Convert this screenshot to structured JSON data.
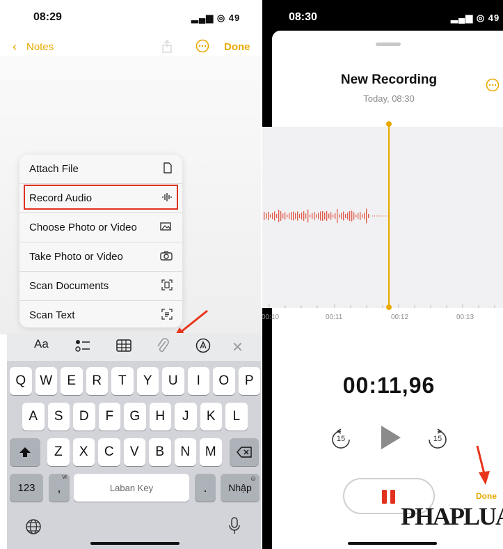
{
  "left_phone": {
    "status": {
      "time": "08:29",
      "icons": "▂▄▆ ◎ 49"
    },
    "nav": {
      "back_label": "Notes",
      "done_label": "Done"
    },
    "attach_menu": {
      "items": [
        {
          "label": "Attach File",
          "icon": "doc-icon"
        },
        {
          "label": "Record Audio",
          "icon": "waveform-icon"
        },
        {
          "label": "Choose Photo or Video",
          "icon": "photo-icon"
        },
        {
          "label": "Take Photo or Video",
          "icon": "camera-icon"
        },
        {
          "label": "Scan Documents",
          "icon": "scan-doc-icon"
        },
        {
          "label": "Scan Text",
          "icon": "scan-text-icon"
        }
      ],
      "highlighted_item": "Record Audio"
    },
    "toolbar": {
      "format_label": "Aa"
    },
    "keyboard": {
      "row1": [
        "Q",
        "W",
        "E",
        "R",
        "T",
        "Y",
        "U",
        "I",
        "O",
        "P"
      ],
      "row2": [
        "A",
        "S",
        "D",
        "F",
        "G",
        "H",
        "J",
        "K",
        "L"
      ],
      "row3": [
        "Z",
        "X",
        "C",
        "V",
        "B",
        "N",
        "M"
      ],
      "numbers_label": "123",
      "comma_label": ",",
      "comma_hint": "VI",
      "space_label": "Laban Key",
      "period_label": ".",
      "return_label": "Nhập"
    }
  },
  "right_phone": {
    "status": {
      "time": "08:30",
      "icons": "▂▄▆ ◎ 49"
    },
    "recording": {
      "title": "New Recording",
      "subtitle": "Today, 08:30",
      "timeline_ticks": [
        "00:10",
        "00:11",
        "00:12",
        "00:13"
      ],
      "elapsed": "00:11,96",
      "skip_back": "15",
      "skip_forward": "15",
      "done_label": "Done"
    },
    "watermark": "PHAPLUAT"
  },
  "colors": {
    "accent": "#e8a900",
    "red": "#e0321e",
    "wave": "#e05a4a"
  }
}
